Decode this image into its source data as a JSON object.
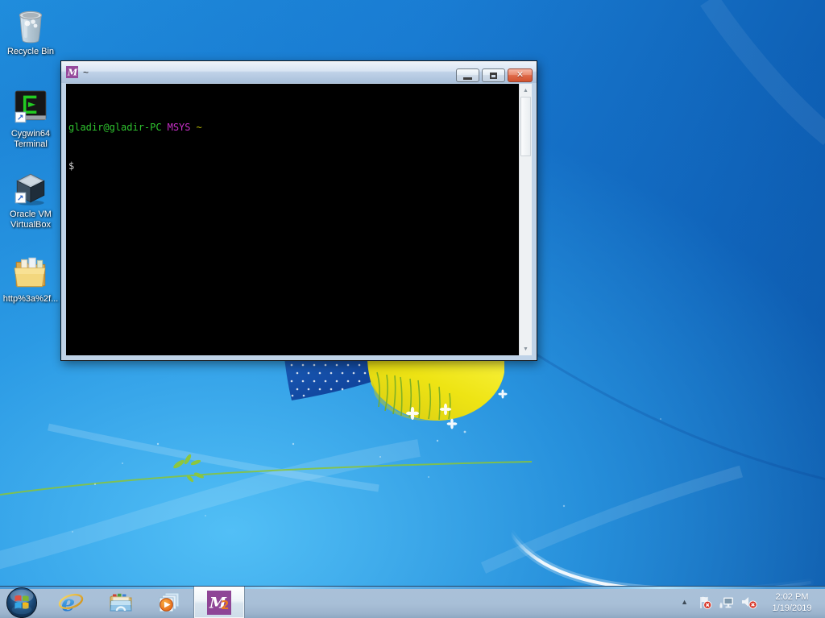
{
  "desktop": {
    "icons": [
      {
        "name": "recycle-bin",
        "lines": [
          "Recycle Bin"
        ]
      },
      {
        "name": "cygwin64-terminal",
        "lines": [
          "Cygwin64",
          "Terminal"
        ]
      },
      {
        "name": "oracle-vm-virtualbox",
        "lines": [
          "Oracle VM",
          "VirtualBox"
        ]
      },
      {
        "name": "http-folder",
        "lines": [
          "http%3a%2f..."
        ]
      }
    ]
  },
  "window": {
    "title": "~",
    "app_icon": "msys-icon",
    "controls": {
      "close_glyph": "✕"
    },
    "terminal": {
      "prompt_user": "gladir@gladir-PC",
      "prompt_system": "MSYS",
      "prompt_path": "~",
      "prompt_symbol": "$"
    },
    "scrollbar": {
      "up_glyph": "▲",
      "down_glyph": "▼"
    }
  },
  "taskbar": {
    "buttons": [
      {
        "name": "internet-explorer"
      },
      {
        "name": "windows-explorer"
      },
      {
        "name": "windows-media-player"
      },
      {
        "name": "msys2-terminal",
        "active": true
      }
    ],
    "tray": {
      "chevron_glyph": "▲",
      "time": "2:02 PM",
      "date": "1/19/2019"
    }
  },
  "colors": {
    "prompt_user_green": "#2fc42f",
    "prompt_system_magenta": "#c62fc6",
    "prompt_path_yellow": "#b8b800",
    "prompt_symbol_gray": "#cfcfcf",
    "terminal_background": "#000000",
    "msys_purple": "#8e4596",
    "taskbar_blue_gray": "#a8bfd7",
    "wallpaper_center_blue": "#35a8ec",
    "wallpaper_edge_blue": "#0a4e9c",
    "close_button_red": "#d2532f"
  }
}
